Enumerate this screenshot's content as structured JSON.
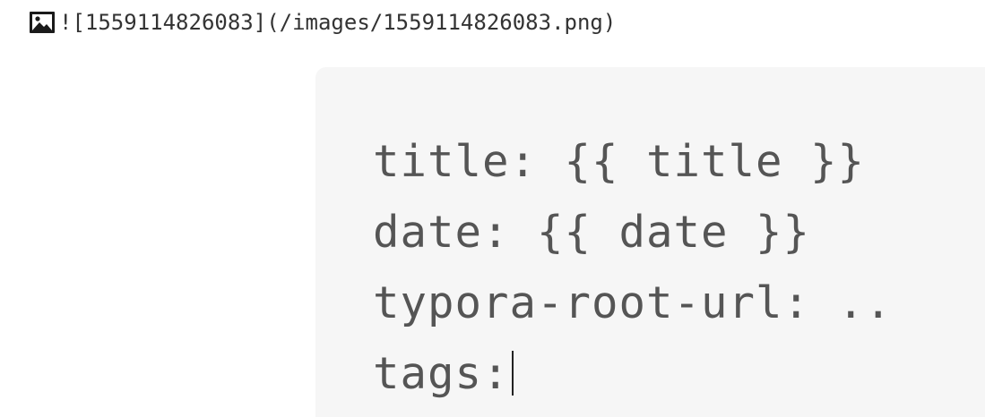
{
  "markdown_image": {
    "icon": "image-icon",
    "text": "![1559114826083](/images/1559114826083.png)"
  },
  "code_block": {
    "lines": [
      "title: {{ title }}",
      "date: {{ date }}",
      "typora-root-url: ..",
      "tags:"
    ]
  }
}
